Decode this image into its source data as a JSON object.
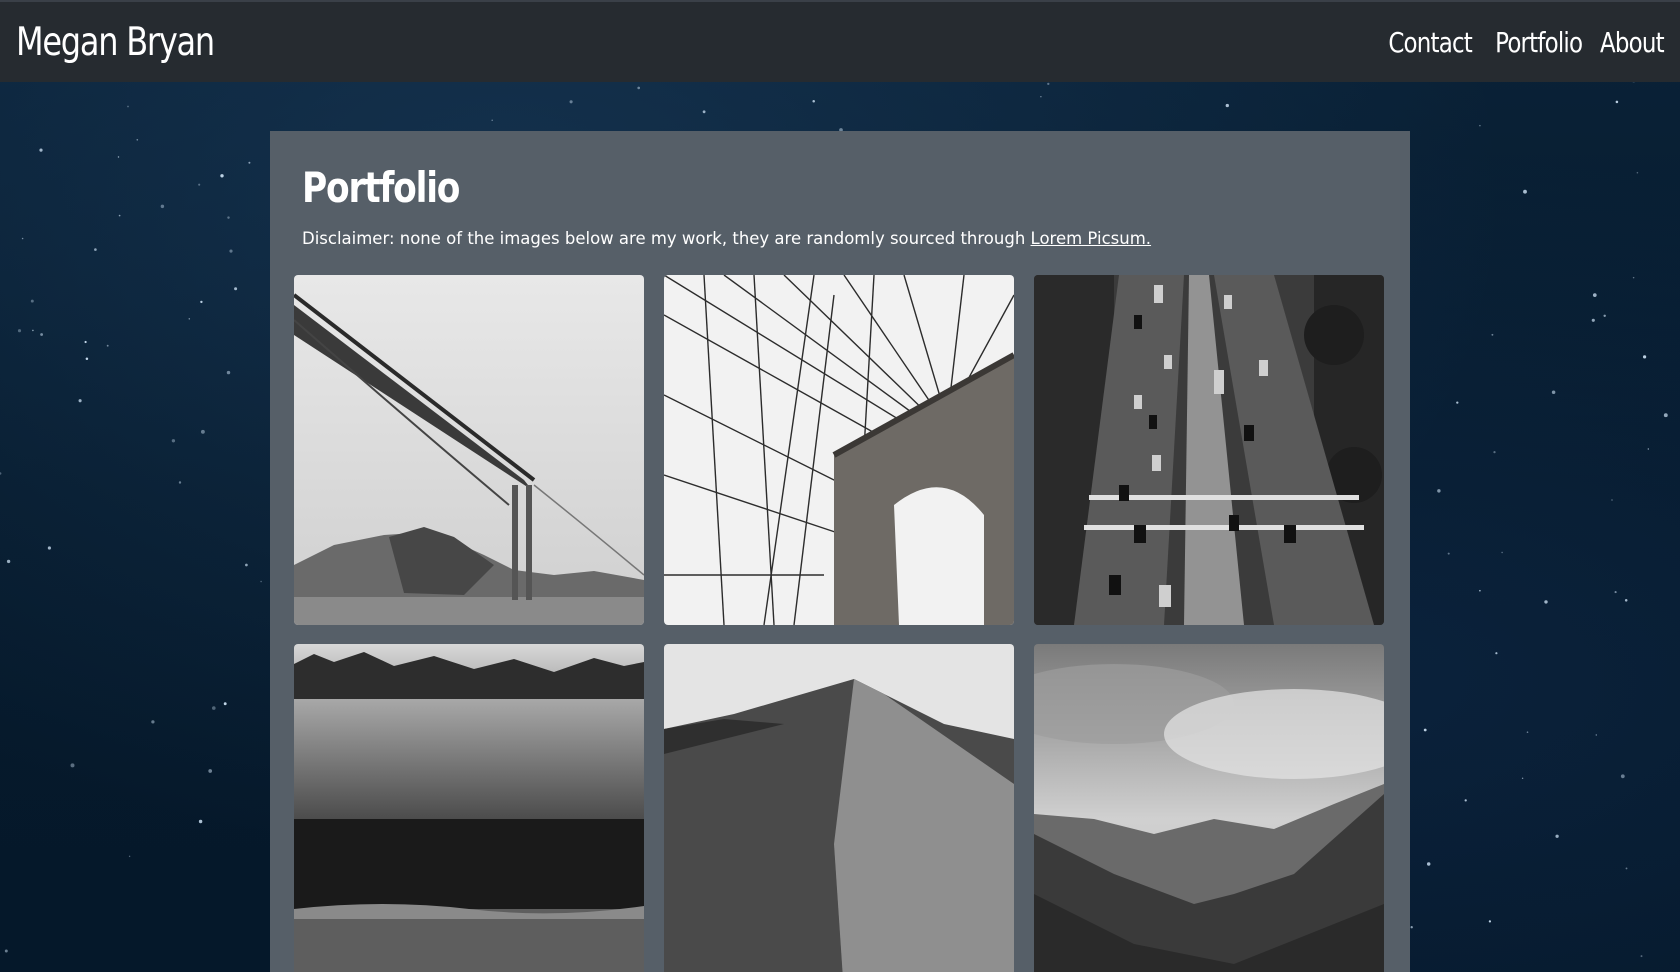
{
  "site": {
    "brand": "Megan Bryan",
    "nav": [
      "Contact",
      "Portfolio",
      "About"
    ]
  },
  "page": {
    "title": "Portfolio",
    "disclaimer_text": "Disclaimer: none of the images below are my work, they are randomly sourced through ",
    "disclaimer_link": "Lorem Picsum."
  },
  "gallery": [
    {
      "subject": "golden-gate-bridge-photo"
    },
    {
      "subject": "brooklyn-bridge-cables-photo"
    },
    {
      "subject": "aerial-highway-traffic-photo"
    },
    {
      "subject": "misty-field-treeline-photo"
    },
    {
      "subject": "sand-dune-ridge-photo"
    },
    {
      "subject": "forested-valley-clouds-photo"
    }
  ],
  "colors": {
    "navbar": "#262b30",
    "panel": "#565f68",
    "background": "#061a2c",
    "text": "#ffffff"
  }
}
